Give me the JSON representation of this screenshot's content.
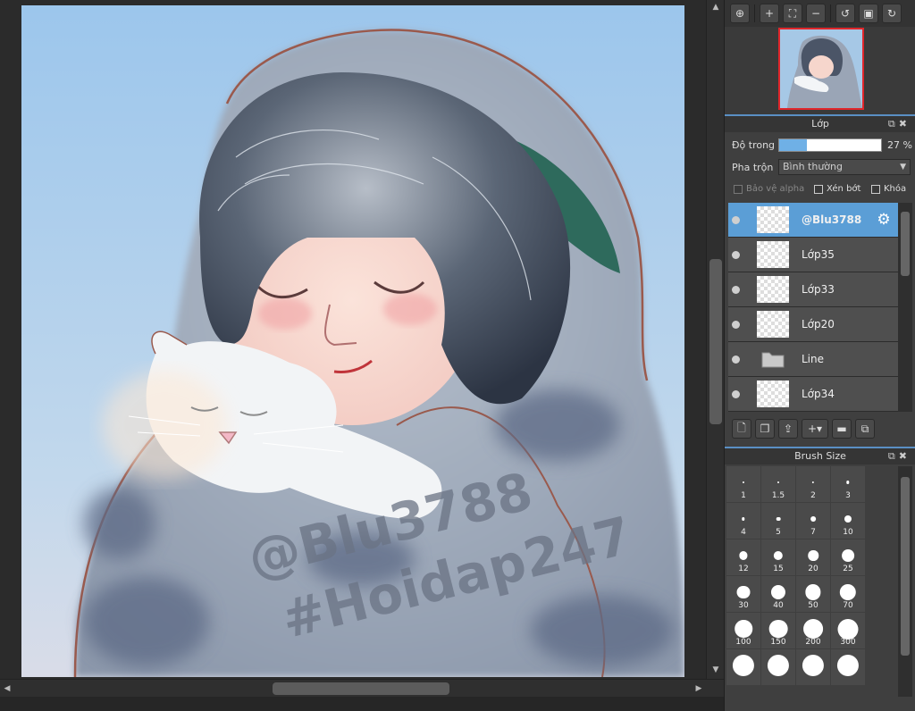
{
  "artwork": {
    "watermark_line1": "@Blu3788",
    "watermark_line2": "#Hoidap247"
  },
  "layer_panel": {
    "title": "Lớp",
    "opacity_label": "Độ trong",
    "opacity_value": "27 %",
    "opacity_fraction": 0.27,
    "blend_label": "Pha trộn",
    "blend_value": "Bình thường",
    "protect_alpha_label": "Bảo vệ alpha",
    "clipping_label": "Xén bớt",
    "lock_label": "Khóa",
    "layers": [
      {
        "name": "@Blu3788",
        "selected": true,
        "type": "layer"
      },
      {
        "name": "Lớp35",
        "selected": false,
        "type": "layer"
      },
      {
        "name": "Lớp33",
        "selected": false,
        "type": "layer"
      },
      {
        "name": "Lớp20",
        "selected": false,
        "type": "layer"
      },
      {
        "name": "Line",
        "selected": false,
        "type": "folder"
      },
      {
        "name": "Lớp34",
        "selected": false,
        "type": "layer"
      }
    ]
  },
  "brush_panel": {
    "title": "Brush Size",
    "sizes": [
      "1",
      "1.5",
      "2",
      "3",
      "4",
      "5",
      "7",
      "10",
      "12",
      "15",
      "20",
      "25",
      "30",
      "40",
      "50",
      "70",
      "100",
      "150",
      "200",
      "300",
      "",
      "",
      "",
      ""
    ]
  },
  "colors": {
    "accent": "#5b9ed6",
    "navigator_frame": "#e0262b"
  }
}
